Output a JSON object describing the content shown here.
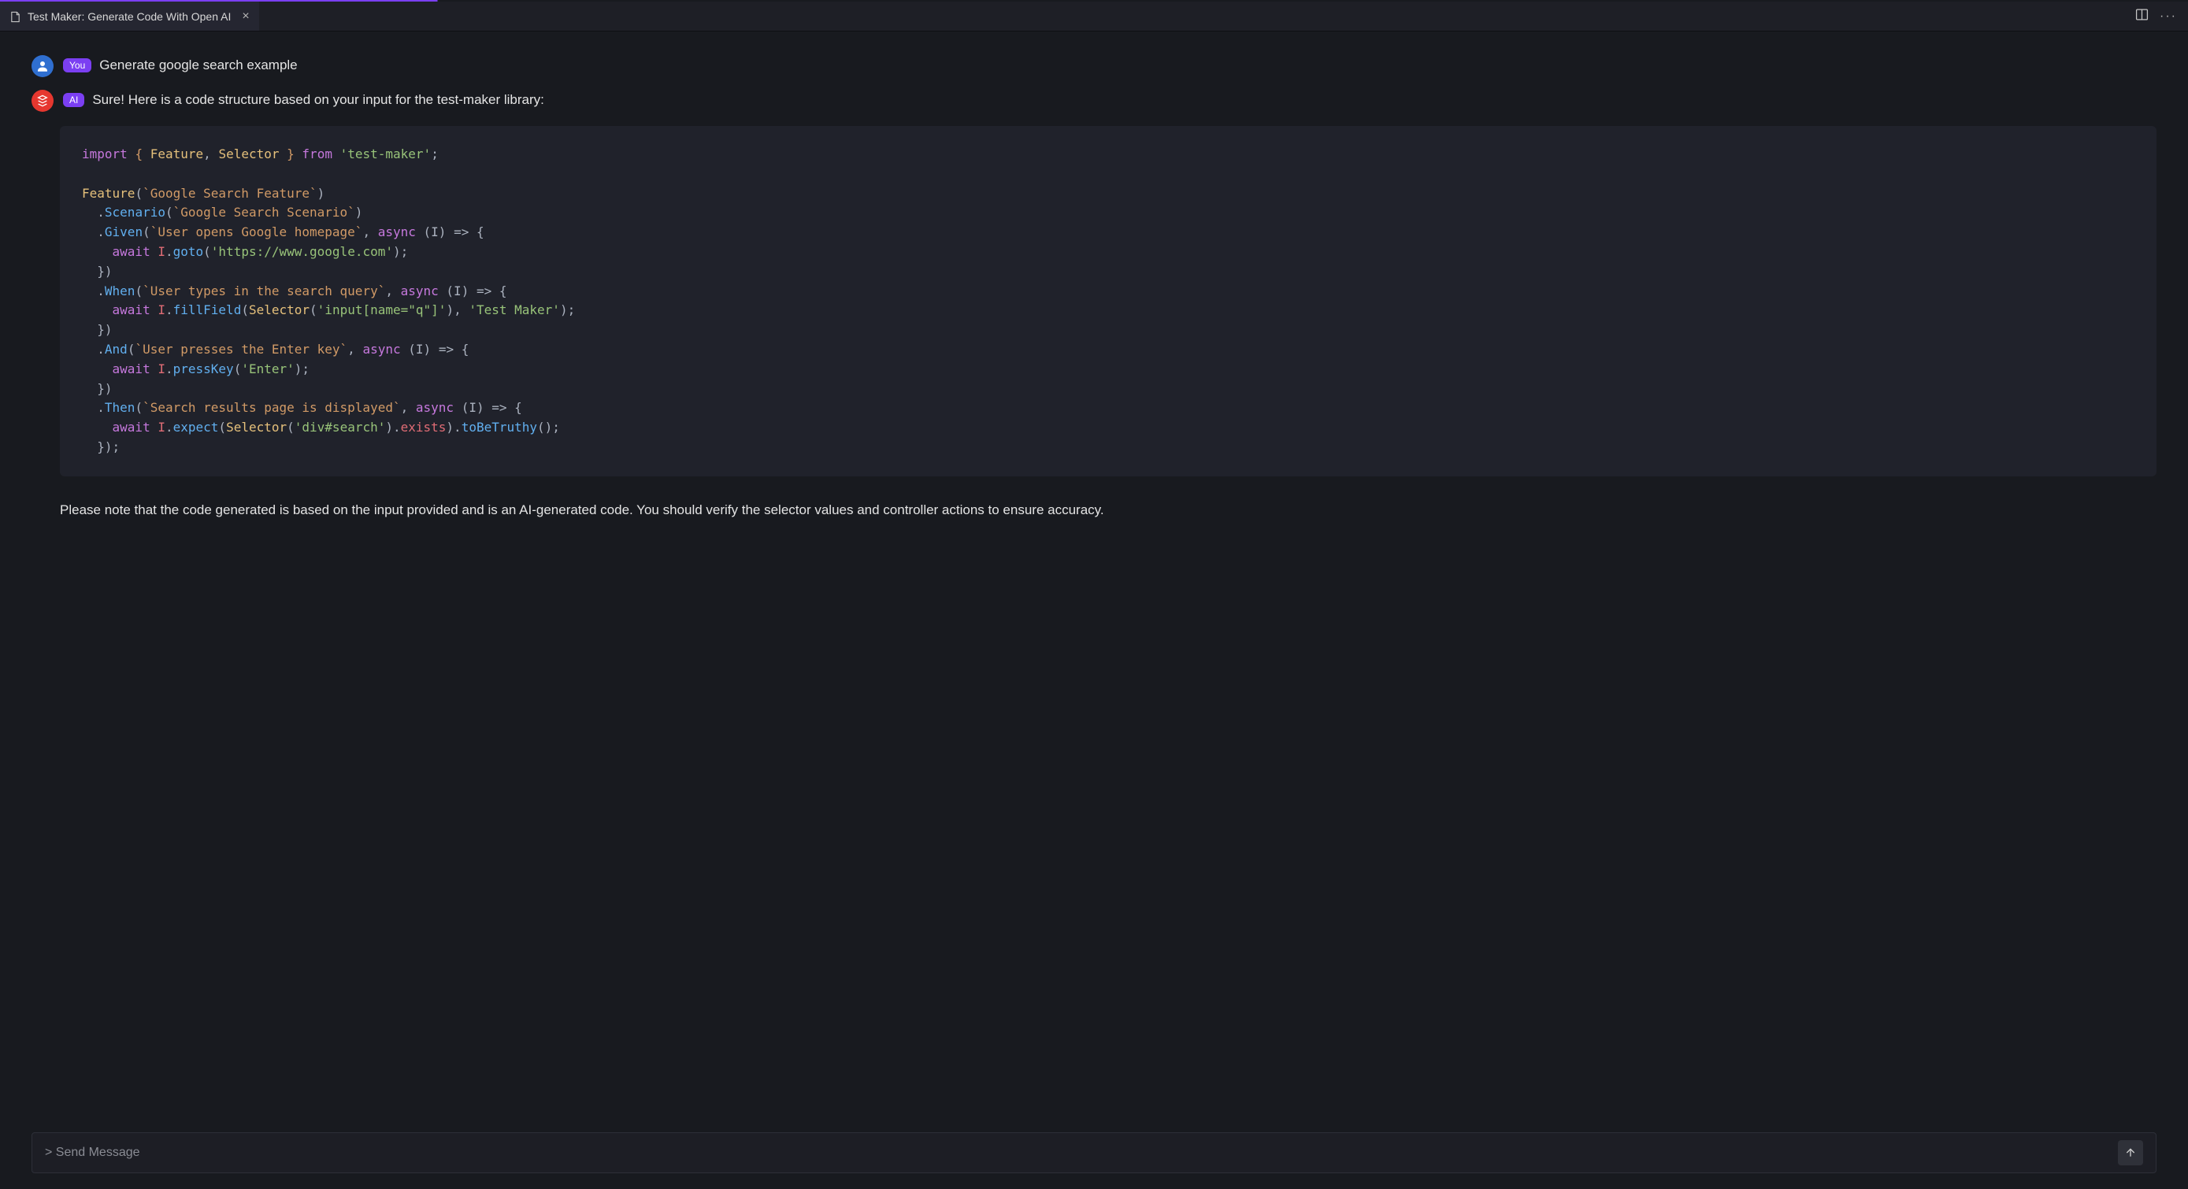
{
  "tab": {
    "title": "Test Maker: Generate Code With Open AI"
  },
  "chat": {
    "user_badge": "You",
    "user_message": "Generate google search example",
    "ai_badge": "AI",
    "ai_message": "Sure! Here is a code structure based on your input for the test-maker library:",
    "follow_note": "Please note that the code generated is based on the input provided and is an AI-generated code. You should verify the selector values and controller actions to ensure accuracy."
  },
  "code": {
    "import_kw": "import",
    "ident_feature": "Feature",
    "ident_selector": "Selector",
    "from_kw": "from",
    "module": "'test-maker'",
    "feature_call": "Feature",
    "feature_name": "`Google Search Feature`",
    "scenario_member": "Scenario",
    "scenario_name": "`Google Search Scenario`",
    "given_member": "Given",
    "given_text": "`User opens Google homepage`",
    "async_kw": "async",
    "param_I": "(I)",
    "arrow": "=>",
    "await_kw": "await",
    "var_I": "I",
    "goto_fn": "goto",
    "goto_arg": "'https://www.google.com'",
    "when_member": "When",
    "when_text": "`User types in the search query`",
    "fillfield_fn": "fillField",
    "selector_call": "Selector",
    "selector_arg1": "'input[name=\"q\"]'",
    "fill_value": "'Test Maker'",
    "and_member": "And",
    "and_text": "`User presses the Enter key`",
    "presskey_fn": "pressKey",
    "presskey_arg": "'Enter'",
    "then_member": "Then",
    "then_text": "`Search results page is displayed`",
    "expect_fn": "expect",
    "selector_arg2": "'div#search'",
    "exists_prop": "exists",
    "tobetruthy_fn": "toBeTruthy"
  },
  "input": {
    "placeholder": "> Send Message"
  }
}
